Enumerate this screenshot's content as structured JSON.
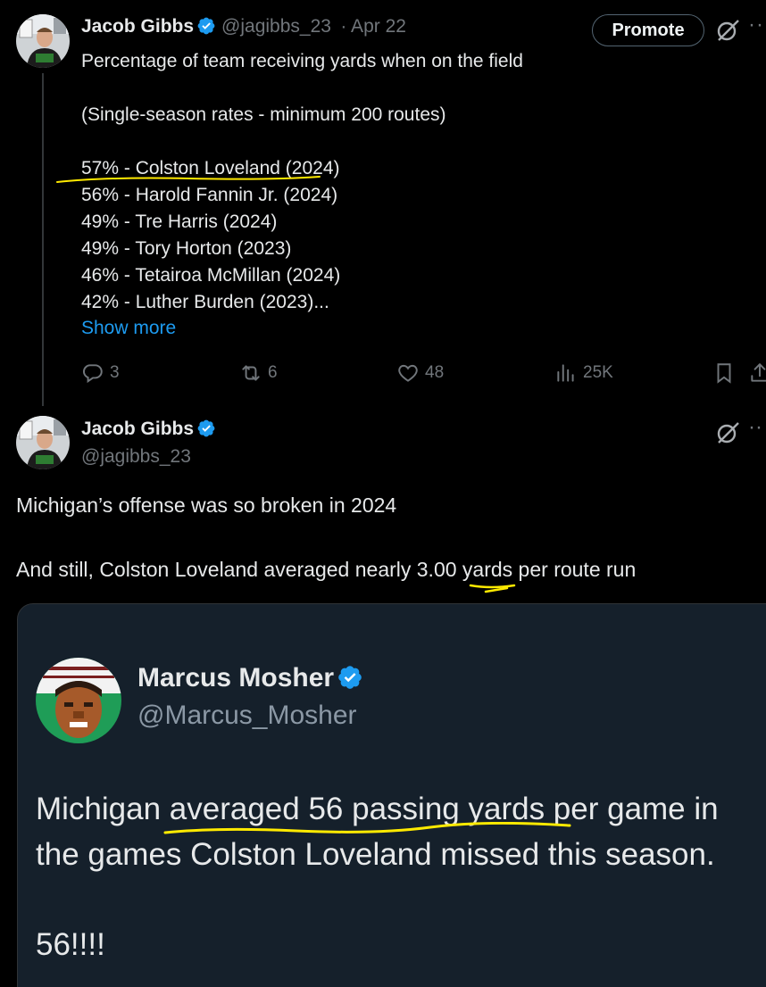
{
  "colors": {
    "background": "#000000",
    "accent": "#1d9bf0",
    "muted": "#71767b",
    "highlight": "#ffea00",
    "quote_bg": "#15202b"
  },
  "tweet1": {
    "name": "Jacob Gibbs",
    "handle": "@jagibbs_23",
    "date": "· Apr 22",
    "promote_label": "Promote",
    "more_label": "··",
    "lines": [
      "Percentage of team receiving yards when on the field",
      "(Single-season rates - minimum 200 routes)",
      "57% - Colston Loveland (2024)",
      "56% - Harold Fannin Jr. (2024)",
      "49% - Tre Harris (2024)",
      "49% - Tory Horton (2023)",
      "46% - Tetairoa McMillan (2024)",
      "42% - Luther Burden (2023)..."
    ],
    "show_more": "Show more",
    "replies": "3",
    "retweets": "6",
    "likes": "48",
    "views": "25K",
    "icons": [
      "verified-badge-icon",
      "grok-icon",
      "reply-icon",
      "retweet-icon",
      "like-icon",
      "views-icon",
      "bookmark-icon",
      "share-icon"
    ]
  },
  "tweet2": {
    "name": "Jacob Gibbs",
    "handle": "@jagibbs_23",
    "more_label": "··",
    "line1": "Michigan’s offense was so broken in 2024",
    "line2": "And still, Colston Loveland averaged nearly 3.00 yards per route run"
  },
  "quote": {
    "name": "Marcus Mosher",
    "handle": "@Marcus_Mosher",
    "lines": [
      "Michigan averaged 56 passing yards per game in",
      "the games Colston Loveland missed this season.",
      "56!!!!"
    ]
  }
}
